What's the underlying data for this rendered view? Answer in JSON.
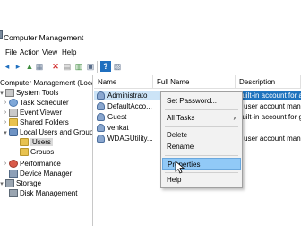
{
  "window": {
    "title": "Computer Management"
  },
  "menubar": {
    "file": "File",
    "action": "Action",
    "view": "View",
    "help": "Help"
  },
  "tree": {
    "root": "Computer Management (Local",
    "system_tools": "System Tools",
    "task_scheduler": "Task Scheduler",
    "event_viewer": "Event Viewer",
    "shared_folders": "Shared Folders",
    "local_users_groups": "Local Users and Groups",
    "users": "Users",
    "groups": "Groups",
    "performance": "Performance",
    "device_manager": "Device Manager",
    "storage": "Storage",
    "disk_management": "Disk Management"
  },
  "list": {
    "columns": {
      "name": "Name",
      "full_name": "Full Name",
      "description": "Description"
    },
    "rows": [
      {
        "name": "Administrato",
        "full_name": "",
        "description": "Built-in account for a"
      },
      {
        "name": "DefaultAcco...",
        "full_name": "",
        "description": "A user account manag"
      },
      {
        "name": "Guest",
        "full_name": "",
        "description": "Built-in account for gu"
      },
      {
        "name": "venkat",
        "full_name": "",
        "description": ""
      },
      {
        "name": "WDAGUtility...",
        "full_name": "",
        "description": "A user account manag"
      }
    ]
  },
  "context_menu": {
    "set_password": "Set Password...",
    "all_tasks": "All Tasks",
    "all_tasks_arrow": "›",
    "delete": "Delete",
    "rename": "Rename",
    "properties": "Properties",
    "help": "Help"
  },
  "icons": {
    "back": "◂",
    "forward": "▸",
    "up": "▲",
    "show_hide_tree": "▦",
    "delete": "✕",
    "properties": "▤",
    "refresh": "▥",
    "export": "▣",
    "help": "?",
    "console": "▧"
  },
  "colors": {
    "selection": "#cce4f7",
    "menu_hover": "#91c9f7",
    "desc_highlight": "#1e73be"
  }
}
